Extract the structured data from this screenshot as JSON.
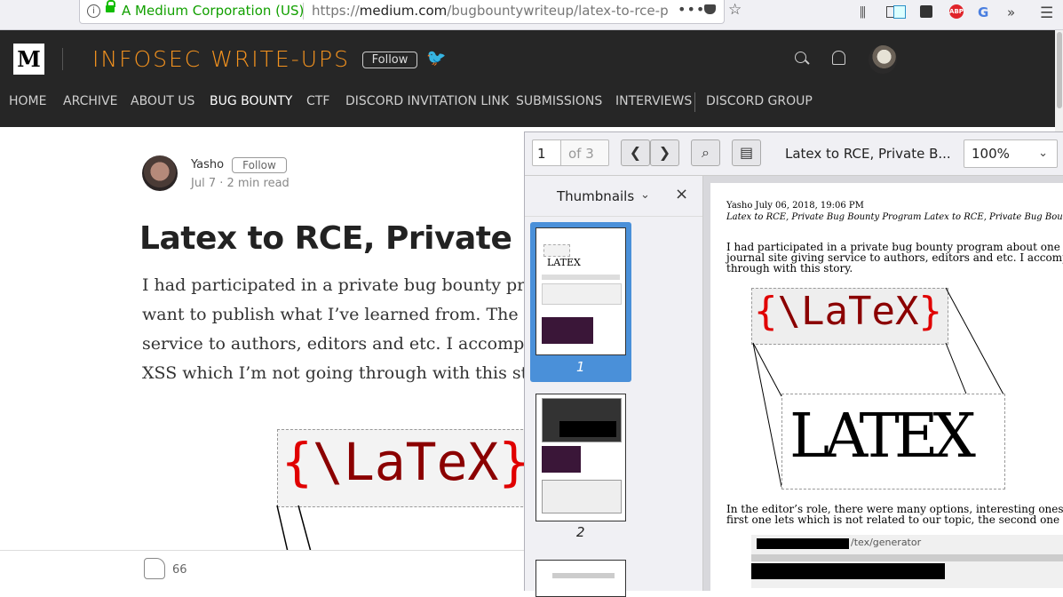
{
  "browser": {
    "site_identity": "A Medium Corporation (US)",
    "url_prefix": "https://",
    "url_domain": "medium.com",
    "url_path": "/bugbountywriteup/latex-to-rce-p",
    "more_label": "•••"
  },
  "header": {
    "logo": "M",
    "publication": "INFOSEC WRITE-UPS",
    "follow_label": "Follow"
  },
  "nav": {
    "items": [
      "HOME",
      "ARCHIVE",
      "ABOUT US",
      "BUG BOUNTY",
      "CTF",
      "DISCORD INVITATION LINK",
      "SUBMISSIONS",
      "INTERVIEWS",
      "DISCORD GROUP"
    ],
    "active": "BUG BOUNTY"
  },
  "article": {
    "author": "Yasho",
    "follow_label": "Follow",
    "meta": "Jul 7 · 2 min read",
    "title": "Latex to RCE, Private Bug B",
    "paragraph_lines": [
      "I had participated in a private bug bounty progr",
      "want to publish what I’ve learned from. The CM",
      "service to authors, editors and etc. I accomplishe",
      "XSS which I’m not going through with this story"
    ],
    "latex_banner": "{\\LaTeX}",
    "clap_count": "66"
  },
  "pdf": {
    "page_current": "1",
    "page_total": "of 3",
    "title": "Latex to RCE, Private B...",
    "zoom": "100%",
    "sidebar_label": "Thumbnails",
    "thumb_labels": [
      "1",
      "2"
    ],
    "page": {
      "header_line1": "Yasho July 06, 2018, 19:06 PM",
      "header_line2": "Latex to RCE, Private Bug Bounty Program Latex to RCE, Private Bug Bounty Pr",
      "para1": [
        "I had participated in a private bug bounty program about one yea",
        "journal site giving service to authors, editors and etc. I accomplis",
        "through with this story."
      ],
      "latex_small": "{\\LaTeX}",
      "latex_big": "LATEX",
      "para2": [
        "In the editor’s role, there were many options, interesting ones we",
        "first one lets which is not related to our topic, the second one see"
      ],
      "url_fragment": "/tex/generator"
    }
  },
  "colors": {
    "accent": "#f5931e",
    "header_bg": "#262626",
    "thumb_selected": "#4a90d9",
    "secure_green": "#12bc00"
  }
}
